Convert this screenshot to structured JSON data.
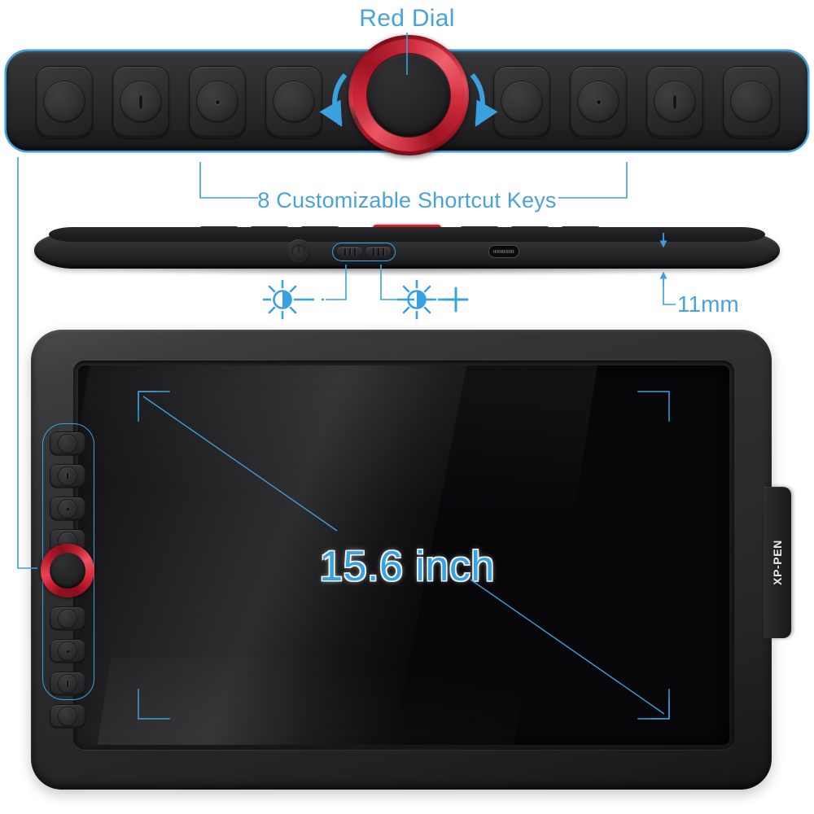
{
  "product": {
    "brand": "XP-PEN",
    "type": "pen-display-drawing-tablet"
  },
  "annotations": {
    "red_dial_label": "Red Dial",
    "shortcut_keys_label": "8 Customizable Shortcut Keys",
    "thickness_label": "11mm",
    "screen_size_label": "15.6 inch"
  },
  "colors": {
    "callout_blue": "#4aa3d8",
    "line_blue": "#3ba0de",
    "screen_text_blue": "#36a3e8",
    "dial_red": "#cf2333",
    "body_black": "#2c2c2e",
    "screen_black": "#07070a"
  },
  "top_keybar": {
    "keys": [
      {
        "index": 1,
        "mark": "none"
      },
      {
        "index": 2,
        "mark": "bar"
      },
      {
        "index": 3,
        "mark": "dot"
      },
      {
        "index": 4,
        "mark": "none"
      },
      {
        "index": 5,
        "mark": "none"
      },
      {
        "index": 6,
        "mark": "dot"
      },
      {
        "index": 7,
        "mark": "bar"
      },
      {
        "index": 8,
        "mark": "none"
      }
    ],
    "dial": {
      "name": "red-dial",
      "rotation_arrows": [
        "counter-clockwise-left",
        "clockwise-right"
      ]
    }
  },
  "side_profile": {
    "power_button": {
      "icon": "power-icon"
    },
    "brightness_buttons": [
      {
        "position": "left",
        "function": "brightness-down",
        "symbol": "−"
      },
      {
        "position": "right",
        "function": "brightness-up",
        "symbol": "+"
      }
    ],
    "brightness_icons": [
      {
        "name": "brightness-down-icon",
        "sign": "minus"
      },
      {
        "name": "brightness-up-icon",
        "sign": "plus"
      }
    ],
    "usb_port": {
      "name": "usb-c-port"
    },
    "thickness_callout": {
      "value": "11mm"
    }
  },
  "tablet": {
    "rail_keys_above": [
      {
        "index": 1,
        "mark": "none"
      },
      {
        "index": 2,
        "mark": "bar"
      },
      {
        "index": 3,
        "mark": "dot"
      },
      {
        "index": 4,
        "mark": "none"
      }
    ],
    "rail_keys_below": [
      {
        "index": 5,
        "mark": "none"
      },
      {
        "index": 6,
        "mark": "dot"
      },
      {
        "index": 7,
        "mark": "bar"
      },
      {
        "index": 8,
        "mark": "none"
      }
    ],
    "rail_dial": {
      "name": "red-dial-side"
    },
    "screen": {
      "diagonal_label": "15.6 inch",
      "corner_brackets": 4,
      "diagonal_lines": 2
    },
    "logo": "XP-PEN"
  }
}
